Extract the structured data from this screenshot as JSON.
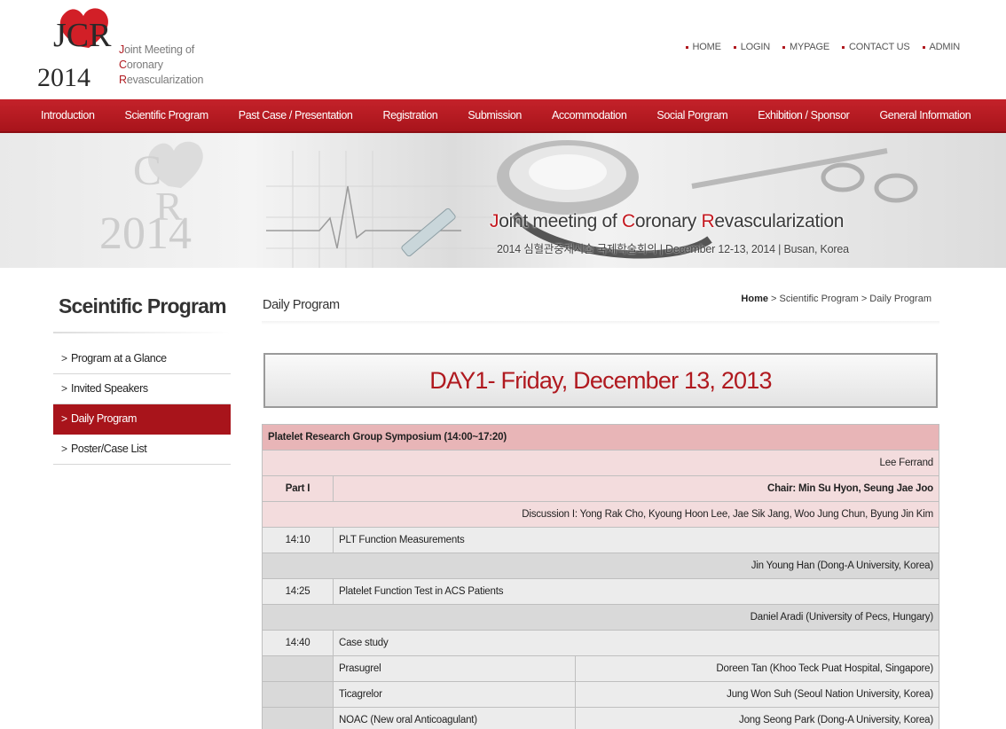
{
  "logo": {
    "text_line1_initial": "J",
    "text_line1_rest": "oint Meeting of",
    "text_line2_initial": "C",
    "text_line2_rest": "oronary",
    "text_line3_initial": "R",
    "text_line3_rest": "evascularization",
    "mark_letters": "JCR",
    "mark_year": "2014"
  },
  "top_links": [
    {
      "label": "HOME"
    },
    {
      "label": "LOGIN"
    },
    {
      "label": "MYPAGE"
    },
    {
      "label": "CONTACT US"
    },
    {
      "label": "ADMIN"
    }
  ],
  "nav": [
    {
      "label": "Introduction"
    },
    {
      "label": "Scientific Program"
    },
    {
      "label": "Past Case / Presentation"
    },
    {
      "label": "Registration"
    },
    {
      "label": "Submission"
    },
    {
      "label": "Accommodation"
    },
    {
      "label": "Social Porgram"
    },
    {
      "label": "Exhibition / Sponsor"
    },
    {
      "label": "General Information"
    }
  ],
  "banner": {
    "title_j": "J",
    "title_1": "oint meeting of ",
    "title_c": "C",
    "title_2": "oronary ",
    "title_r": "R",
    "title_3": "evascularization",
    "subtitle": "2014 심혈관중재시술 국제학술회의 | December 12-13, 2014   | Busan, Korea",
    "watermark_year": "2014"
  },
  "sidebar": {
    "title": "Sceintific Program",
    "items": [
      {
        "label": "Program at a Glance",
        "active": false
      },
      {
        "label": "Invited Speakers",
        "active": false
      },
      {
        "label": "Daily Program",
        "active": true
      },
      {
        "label": "Poster/Case List",
        "active": false
      }
    ]
  },
  "content": {
    "page_title": "Daily Program",
    "breadcrumb": {
      "home": "Home",
      "rest": " > Scientific Program > Daily Program"
    },
    "day_title": "DAY1- Friday, December 13, 2013"
  },
  "program": {
    "header": "Platelet Research Group Symposium (14:00~17:20)",
    "organizer": "Lee Ferrand",
    "part_label": "Part I",
    "part_chair": "Chair: Min Su Hyon, Seung Jae Joo",
    "discussion": "Discussion I: Yong Rak Cho, Kyoung Hoon Lee, Jae Sik Jang, Woo Jung Chun, Byung Jin Kim",
    "talks": [
      {
        "time": "14:10",
        "title": "PLT Function Measurements",
        "speaker": "Jin Young Han (Dong-A University, Korea)"
      },
      {
        "time": "14:25",
        "title": "Platelet Function Test in ACS Patients",
        "speaker": "Daniel Aradi (University of Pecs, Hungary)"
      },
      {
        "time": "14:40",
        "title": "Case study",
        "speaker": ""
      }
    ],
    "case_rows": [
      {
        "title": "Prasugrel",
        "speaker": "Doreen Tan (Khoo Teck Puat Hospital, Singapore)"
      },
      {
        "title": "Ticagrelor",
        "speaker": "Jung Won Suh (Seoul Nation University, Korea)"
      },
      {
        "title": "NOAC (New oral Anticoagulant)",
        "speaker": "Jong Seong Park (Dong-A University, Korea)"
      }
    ]
  }
}
